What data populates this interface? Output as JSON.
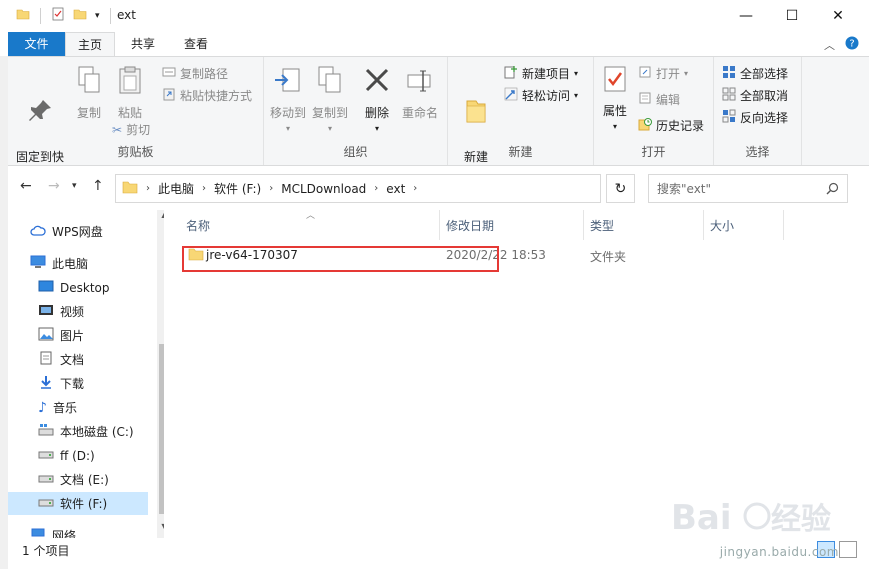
{
  "window": {
    "title": "ext",
    "minimize": "—",
    "maximize": "☐",
    "close": "✕"
  },
  "tabs": {
    "file": "文件",
    "home": "主页",
    "share": "共享",
    "view": "查看"
  },
  "ribbon": {
    "clipboard": {
      "pin": "固定到快\n速访问",
      "copy": "复制",
      "paste": "粘贴",
      "copy_path": "复制路径",
      "paste_shortcut": "粘贴快捷方式",
      "cut": "剪切",
      "label": "剪贴板"
    },
    "organize": {
      "move_to": "移动到",
      "copy_to": "复制到",
      "delete": "删除",
      "rename": "重命名",
      "label": "组织"
    },
    "new": {
      "new_folder": "新建\n文件夹",
      "new_item": "新建项目",
      "easy_access": "轻松访问",
      "label": "新建"
    },
    "open": {
      "properties": "属性",
      "open": "打开",
      "edit": "编辑",
      "history": "历史记录",
      "label": "打开"
    },
    "select": {
      "select_all": "全部选择",
      "select_none": "全部取消",
      "invert": "反向选择",
      "label": "选择"
    }
  },
  "address": {
    "crumbs": [
      "此电脑",
      "软件 (F:)",
      "MCLDownload",
      "ext"
    ]
  },
  "search": {
    "placeholder": "搜索\"ext\""
  },
  "nav": {
    "items": [
      {
        "label": "WPS网盘"
      },
      {
        "label": "此电脑"
      },
      {
        "label": "Desktop"
      },
      {
        "label": "视频"
      },
      {
        "label": "图片"
      },
      {
        "label": "文档"
      },
      {
        "label": "下载"
      },
      {
        "label": "音乐"
      },
      {
        "label": "本地磁盘 (C:)"
      },
      {
        "label": "ff (D:)"
      },
      {
        "label": "文档 (E:)"
      },
      {
        "label": "软件 (F:)"
      },
      {
        "label": "网络"
      }
    ]
  },
  "columns": {
    "name": "名称",
    "modified": "修改日期",
    "type": "类型",
    "size": "大小"
  },
  "files": [
    {
      "name": "jre-v64-170307",
      "modified": "2020/2/22 18:53",
      "type": "文件夹",
      "size": ""
    }
  ],
  "status": {
    "count": "1 个项目"
  },
  "colors": {
    "accent": "#1979ca",
    "selection": "#cce8ff",
    "highlight_box": "#e53935",
    "folder": "#f8d775"
  },
  "watermark": {
    "url": "jingyan.baidu.com"
  }
}
